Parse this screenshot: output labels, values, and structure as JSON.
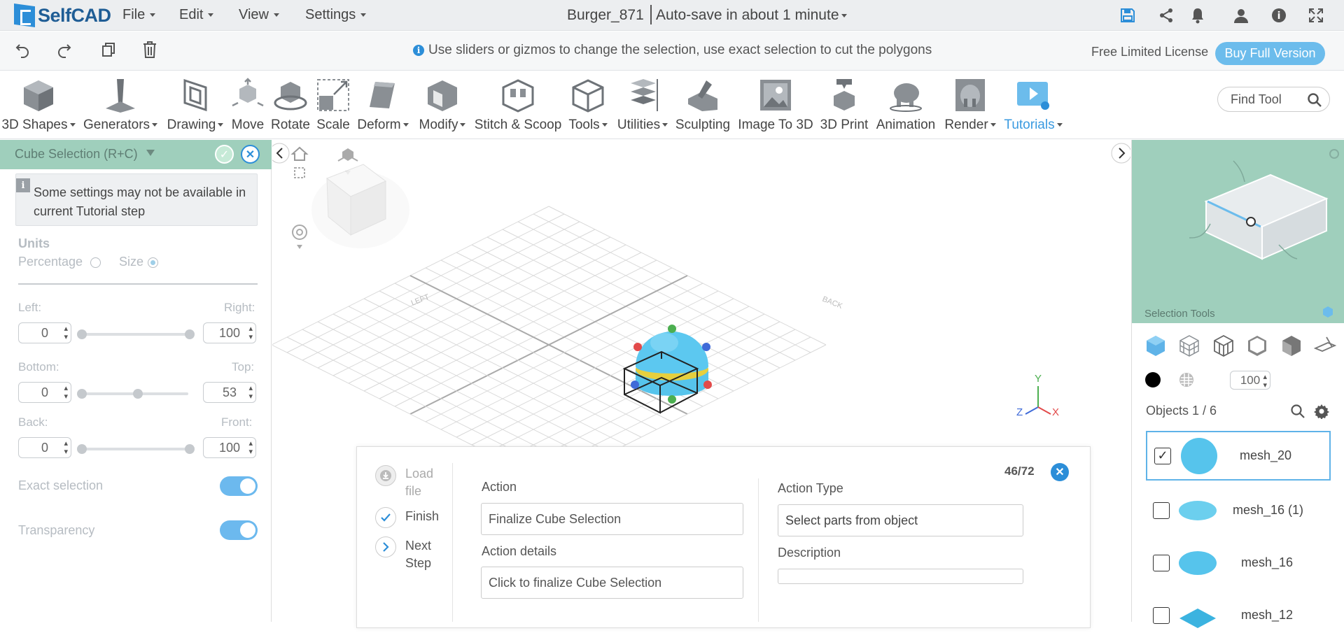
{
  "app": {
    "logo_text": "SelfCAD",
    "menus": [
      "File",
      "Edit",
      "View",
      "Settings"
    ],
    "document_name": "Burger_871",
    "autosave": "Auto-save in about 1 minute"
  },
  "hint_bar": {
    "hint": "Use sliders or gizmos to change the selection, use exact selection to cut the polygons",
    "license": "Free Limited License",
    "buy_button": "Buy Full Version"
  },
  "toolbar": {
    "tools": [
      "3D Shapes",
      "Generators",
      "Drawing",
      "Move",
      "Rotate",
      "Scale",
      "Deform",
      "Modify",
      "Stitch & Scoop",
      "Tools",
      "Utilities",
      "Sculpting",
      "Image To 3D",
      "3D Print",
      "Animation",
      "Render",
      "Tutorials"
    ],
    "find_tool_placeholder": "Find Tool"
  },
  "left_panel": {
    "title": "Cube Selection (R+C)",
    "warning": "Some settings may not be available in current Tutorial step",
    "units_label": "Units",
    "unit_percentage": "Percentage",
    "unit_size": "Size",
    "selected_unit": "Size",
    "left_label": "Left:",
    "right_label": "Right:",
    "left_value": "0",
    "right_value": "100",
    "bottom_label": "Bottom:",
    "top_label": "Top:",
    "bottom_value": "0",
    "top_value": "53",
    "back_label": "Back:",
    "front_label": "Front:",
    "back_value": "0",
    "front_value": "100",
    "exact_selection_label": "Exact selection",
    "exact_selection_on": true,
    "transparency_label": "Transparency",
    "transparency_on": true
  },
  "viewport": {
    "axis_labels": [
      "Y",
      "Z",
      "X"
    ],
    "grid_labels": [
      "LEFT",
      "BACK"
    ]
  },
  "tutorial": {
    "progress": "46/72",
    "steps": [
      {
        "label": "Load file"
      },
      {
        "label": "Finish"
      },
      {
        "label": "Next Step"
      }
    ],
    "action_label": "Action",
    "action_value": "Finalize Cube Selection",
    "action_details_label": "Action details",
    "action_details_value": "Click to finalize Cube Selection",
    "action_type_label": "Action Type",
    "action_type_value": "Select parts from object",
    "description_label": "Description",
    "description_value": ""
  },
  "right_panel": {
    "preview_texts": [
      "Selection Tools"
    ],
    "opacity_value": "100",
    "objects_label": "Objects 1 / 6",
    "objects": [
      {
        "name": "mesh_20",
        "checked": true
      },
      {
        "name": "mesh_16 (1)",
        "checked": false
      },
      {
        "name": "mesh_16",
        "checked": false
      },
      {
        "name": "mesh_12",
        "checked": false
      }
    ]
  },
  "colors": {
    "accent": "#2c8ed8",
    "panel_header": "#9fcfbc",
    "toggle_on": "#6cb9ee",
    "model": "#56c4ec"
  }
}
